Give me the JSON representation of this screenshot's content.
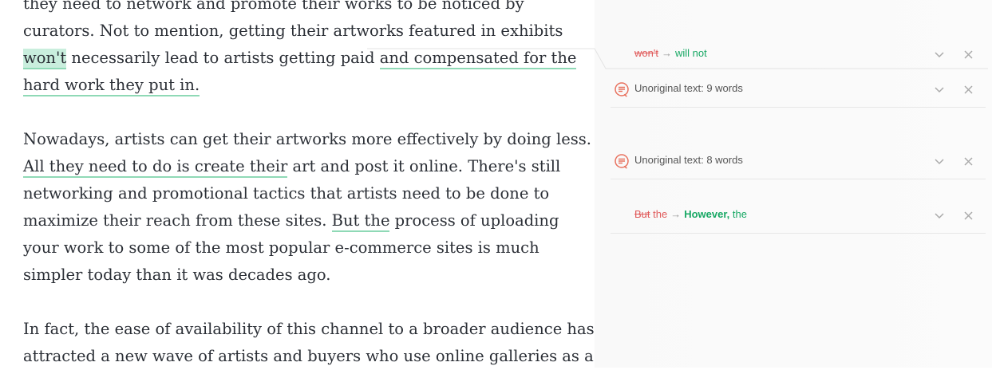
{
  "document": {
    "paragraphs": [
      {
        "lines": [
          [
            {
              "t": "they need to network and promote their works to be noticed by"
            }
          ],
          [
            {
              "t": "curators. Not to mention, getting their artworks featured in exhibits"
            }
          ],
          [
            {
              "t": "won't",
              "h": "fill"
            },
            {
              "t": " necessarily lead to artists getting paid "
            },
            {
              "t": "and compensated for the",
              "h": "line"
            }
          ],
          [
            {
              "t": "hard work they put in.",
              "h": "line"
            }
          ]
        ]
      },
      {
        "lines": [
          [
            {
              "t": "Nowadays, artists can get their artworks more effectively by doing less."
            }
          ],
          [
            {
              "t": "All they need to do is create their",
              "h": "line"
            },
            {
              "t": " art and post it online. There's still"
            }
          ],
          [
            {
              "t": "networking and promotional tactics that artists need to be done to"
            }
          ],
          [
            {
              "t": "maximize their reach from these sites. "
            },
            {
              "t": "But the",
              "h": "line"
            },
            {
              "t": " process of uploading"
            }
          ],
          [
            {
              "t": "your work to some of the most popular e-commerce sites is much"
            }
          ],
          [
            {
              "t": "simpler today than it was decades ago."
            }
          ]
        ]
      },
      {
        "lines": [
          [
            {
              "t": "In fact, the ease of availability of this channel to a broader audience has"
            }
          ],
          [
            {
              "t": "attracted a new wave of artists and buyers who use online galleries as a"
            }
          ]
        ]
      }
    ]
  },
  "sidebar": {
    "cards": [
      {
        "type": "correction",
        "old": "won't",
        "new": "will not",
        "icon": "none"
      },
      {
        "type": "plagiarism",
        "label": "Unoriginal text: 9 words",
        "icon": "plagiarism-icon"
      },
      {
        "type": "plagiarism",
        "label": "Unoriginal text: 8 words",
        "icon": "plagiarism-icon"
      },
      {
        "type": "correction-rich",
        "old_strike": "But",
        "old_plain": " the",
        "new_bold": "However,",
        "new_plain": " the",
        "icon": "none"
      }
    ],
    "arrow": "→"
  },
  "colors": {
    "highlight_underline": "#8fd9b6",
    "highlight_fill": "#c9eedd",
    "error_red": "#e05a5a",
    "suggest_green": "#17a864",
    "plagiarism_icon": "#e8725f"
  }
}
